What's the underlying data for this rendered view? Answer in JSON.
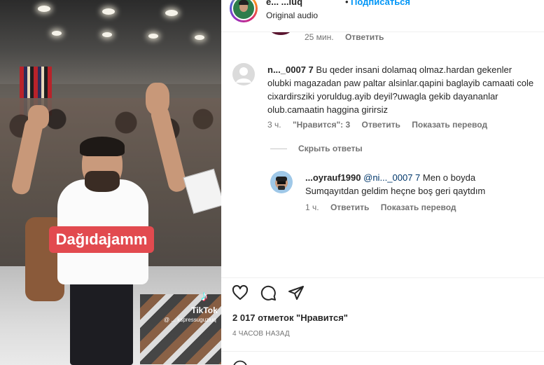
{
  "media": {
    "sticker_text": "Dağıdajamm",
    "watermark_name": "TikTok",
    "watermark_user": "@ ... kspressuguzluq"
  },
  "header": {
    "username": "e... ...luq",
    "separator": "•",
    "follow_label": "Подписаться",
    "audio_label": "Original audio"
  },
  "comments": {
    "prev_meta": {
      "time": "25 мин.",
      "reply": "Ответить"
    },
    "main": {
      "username": "n..._0007 7",
      "text": "Bu qeder insani dolamaq olmaz.hardan gekenler olubki magazadan paw paltar alsinlar.qapini baglayib camaati cole cixardirsziki yoruldug.ayib deyil?uwagla gekib dayananlar olub.camaatin haggina girirsiz",
      "time": "3 ч.",
      "likes": "\"Нравится\": 3",
      "reply": "Ответить",
      "translate": "Показать перевод"
    },
    "hide_replies_label": "Скрыть ответы",
    "reply": {
      "username": "...oyrauf1990",
      "mention": "@ni..._0007 7",
      "text": "Men o boyda Sumqayıtdan geldim heçne boş geri qaytdım",
      "time": "1 ч.",
      "reply": "Ответить",
      "translate": "Показать перевод"
    }
  },
  "actions": {
    "icons": [
      "heart-icon",
      "comment-icon",
      "share-icon"
    ],
    "likes_count": "2 017 отметок \"Нравится\"",
    "time_ago": "4 ЧАСОВ НАЗАД"
  },
  "colors": {
    "accent": "#0095f6",
    "secondary_text": "#737373",
    "sticker_bg": "#e24a4f"
  }
}
